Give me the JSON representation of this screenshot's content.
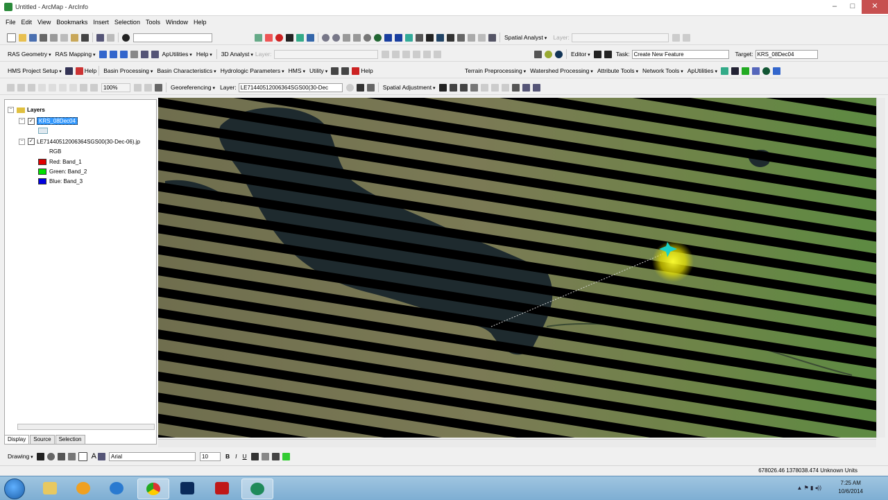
{
  "window": {
    "title": "Untitled - ArcMap - ArcInfo",
    "controls": [
      "–",
      "□",
      "✕"
    ]
  },
  "menubar": [
    "File",
    "Edit",
    "View",
    "Bookmarks",
    "Insert",
    "Selection",
    "Tools",
    "Window",
    "Help"
  ],
  "toolbar1": {
    "scale_value": "",
    "spatial_analyst": "Spatial Analyst",
    "layer_label": "Layer:",
    "layer_value": ""
  },
  "toolbar2": {
    "ras_geometry": "RAS Geometry",
    "ras_mapping": "RAS Mapping",
    "ap_utilities": "ApUtilities",
    "help": "Help",
    "analyst_3d": "3D Analyst",
    "layer_label": "Layer:",
    "editor": "Editor",
    "task_label": "Task:",
    "task_value": "Create New Feature",
    "target_label": "Target:",
    "target_value": "KRS_08Dec04"
  },
  "toolbar3": {
    "hms_project_setup": "HMS Project Setup",
    "help": "Help",
    "basin_processing": "Basin Processing",
    "basin_characteristics": "Basin Characteristics",
    "hydrologic_parameters": "Hydrologic Parameters",
    "hms": "HMS",
    "utility": "Utility",
    "help2": "Help",
    "terrain_preprocessing": "Terrain Preprocessing",
    "watershed_processing": "Watershed Processing",
    "attribute_tools": "Attribute Tools",
    "network_tools": "Network Tools",
    "ap_utilities": "ApUtilities"
  },
  "toolbar4": {
    "zoom_value": "100%",
    "georeferencing": "Georeferencing",
    "layer_label": "Layer:",
    "layer_value": "LE71440512006364SGS00(30-Dec",
    "spatial_adjustment": "Spatial Adjustment"
  },
  "toc": {
    "root": "Layers",
    "layer1": "KRS_08Dec04",
    "layer2": "LE71440512006364SGS00(30-Dec-06).jp",
    "rgb_label": "RGB",
    "bands": [
      {
        "label": "Red:   Band_1",
        "color": "#e00000"
      },
      {
        "label": "Green: Band_2",
        "color": "#00e000"
      },
      {
        "label": "Blue:  Band_3",
        "color": "#0000e0"
      }
    ],
    "tabs": [
      "Display",
      "Source",
      "Selection"
    ]
  },
  "drawing": {
    "drawing_label": "Drawing",
    "font_name": "Arial",
    "font_size": "10",
    "bold": "B",
    "italic": "I",
    "underline": "U",
    "text_tool": "A"
  },
  "status": {
    "coords": "678026.46  1378038.474 Unknown Units"
  },
  "taskbar": {
    "time": "7:25 AM",
    "date": "10/6/2014"
  },
  "colors": {
    "water": "#1e2a2e",
    "stripe": "#000000",
    "highlight": "#f5f000",
    "feature": "#19d0c8",
    "close_btn": "#c75050"
  }
}
